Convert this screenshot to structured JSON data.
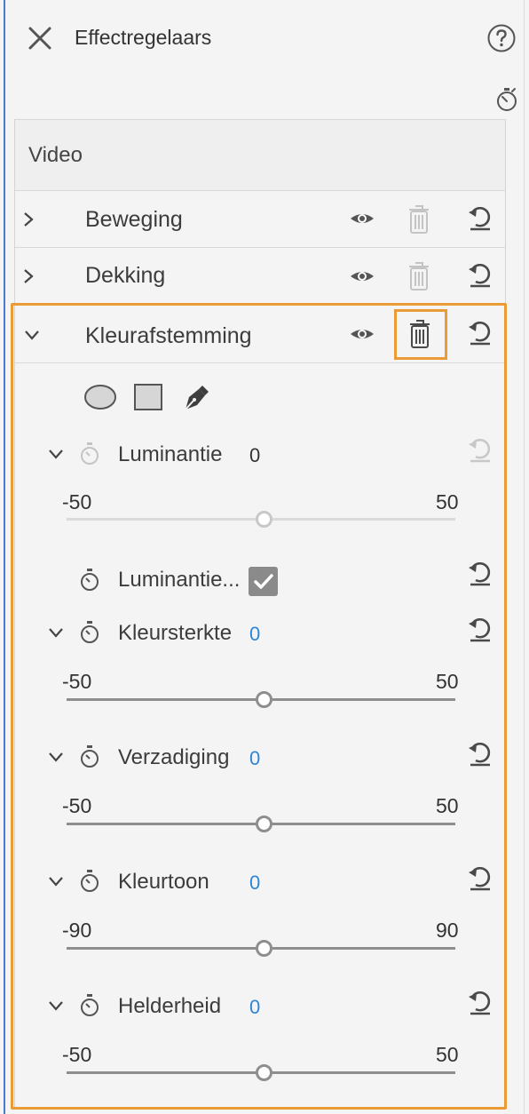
{
  "window": {
    "title": "Effectregelaars"
  },
  "section": {
    "label": "Video"
  },
  "effects": [
    {
      "label": "Beweging"
    },
    {
      "label": "Dekking"
    },
    {
      "label": "Kleurafstemming"
    }
  ],
  "properties": [
    {
      "label": "Luminantie",
      "value": "0",
      "min": "-50",
      "max": "50",
      "position": 0.5
    },
    {
      "label": "Luminantie...",
      "checked": true
    },
    {
      "label": "Kleursterkte",
      "value": "0",
      "min": "-50",
      "max": "50",
      "position": 0.5
    },
    {
      "label": "Verzadiging",
      "value": "0",
      "min": "-50",
      "max": "50",
      "position": 0.5
    },
    {
      "label": "Kleurtoon",
      "value": "0",
      "min": "-90",
      "max": "90",
      "position": 0.5
    },
    {
      "label": "Helderheid",
      "value": "0",
      "min": "-50",
      "max": "50",
      "position": 0.5
    }
  ],
  "colors": {
    "accent_highlight": "#eb9b36",
    "value_blue": "#2e86d6"
  }
}
